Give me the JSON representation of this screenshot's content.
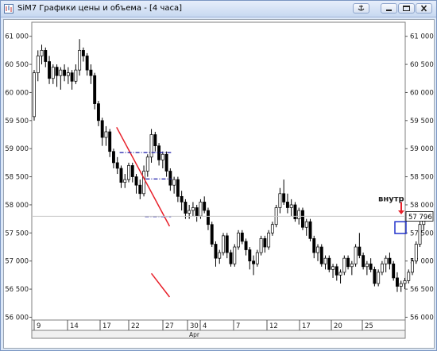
{
  "window": {
    "title": "SiM7 Графики цены и объема - [4 часа]",
    "icons": [
      "chart-app-icon",
      "anchor-icon",
      "minimize-icon",
      "restore-icon",
      "close-icon"
    ]
  },
  "chart_data": {
    "type": "candlestick",
    "y_ticks": [
      "61 000",
      "60 500",
      "60 000",
      "59 500",
      "59 000",
      "58 500",
      "58 000",
      "57 500",
      "57 000",
      "56 500",
      "56 000"
    ],
    "y_tick_values": [
      61000,
      60500,
      60000,
      59500,
      59000,
      58500,
      58000,
      57500,
      57000,
      56500,
      56000
    ],
    "ylim": [
      55950,
      61250
    ],
    "x_ticks": [
      "9",
      "14",
      "17",
      "22",
      "27",
      "30",
      "4",
      "7",
      "12",
      "17",
      "20",
      "25"
    ],
    "month_label": "Apr",
    "last_price": "57 796",
    "annotation": "внутр",
    "grid": "off",
    "colors": {
      "bull": "#ffffff",
      "bear": "#000000",
      "wick": "#000000",
      "trendline": "#e8202a",
      "level": "#1a1aa8",
      "marker": "#2233cc",
      "arrow": "#e8202a"
    },
    "candles": [
      [
        59570,
        60400,
        59500,
        60350
      ],
      [
        60350,
        60750,
        60200,
        60650
      ],
      [
        60650,
        60850,
        60500,
        60750
      ],
      [
        60750,
        60800,
        60450,
        60550
      ],
      [
        60550,
        60650,
        60150,
        60250
      ],
      [
        60250,
        60500,
        60150,
        60450
      ],
      [
        60450,
        60500,
        60100,
        60300
      ],
      [
        60300,
        60450,
        60050,
        60400
      ],
      [
        60400,
        60500,
        60200,
        60300
      ],
      [
        60300,
        60450,
        60150,
        60350
      ],
      [
        60350,
        60400,
        60050,
        60200
      ],
      [
        60200,
        60500,
        60150,
        60400
      ],
      [
        60400,
        60950,
        60300,
        60750
      ],
      [
        60750,
        60800,
        60550,
        60650
      ],
      [
        60650,
        60700,
        60300,
        60400
      ],
      [
        60400,
        60500,
        60150,
        60300
      ],
      [
        60300,
        60350,
        59700,
        59800
      ],
      [
        59800,
        59850,
        59400,
        59500
      ],
      [
        59500,
        59550,
        59050,
        59200
      ],
      [
        59200,
        59400,
        59050,
        59300
      ],
      [
        59300,
        59350,
        58850,
        58950
      ],
      [
        58950,
        59000,
        58650,
        58750
      ],
      [
        58750,
        58850,
        58550,
        58650
      ],
      [
        58650,
        58700,
        58300,
        58400
      ],
      [
        58400,
        58550,
        58300,
        58450
      ],
      [
        58450,
        58750,
        58400,
        58700
      ],
      [
        58700,
        58750,
        58400,
        58500
      ],
      [
        58500,
        58550,
        58200,
        58350
      ],
      [
        58350,
        58450,
        58100,
        58200
      ],
      [
        58200,
        58700,
        58150,
        58600
      ],
      [
        58600,
        58900,
        58500,
        58850
      ],
      [
        58850,
        59350,
        58750,
        59250
      ],
      [
        59250,
        59300,
        58950,
        59050
      ],
      [
        59050,
        59100,
        58700,
        58800
      ],
      [
        58800,
        58950,
        58650,
        58900
      ],
      [
        58900,
        58950,
        58500,
        58600
      ],
      [
        58600,
        58650,
        58250,
        58350
      ],
      [
        58350,
        58500,
        58200,
        58450
      ],
      [
        58450,
        58500,
        58050,
        58150
      ],
      [
        58150,
        58250,
        57900,
        58050
      ],
      [
        58050,
        58100,
        57750,
        57850
      ],
      [
        57850,
        58000,
        57750,
        57900
      ],
      [
        57900,
        58050,
        57800,
        57950
      ],
      [
        57950,
        58000,
        57700,
        57800
      ],
      [
        57800,
        58100,
        57750,
        58050
      ],
      [
        58050,
        58150,
        57850,
        57900
      ],
      [
        57900,
        57950,
        57550,
        57650
      ],
      [
        57650,
        57700,
        57250,
        57300
      ],
      [
        57300,
        57350,
        56900,
        57050
      ],
      [
        57050,
        57200,
        56950,
        57150
      ],
      [
        57150,
        57500,
        57100,
        57450
      ],
      [
        57450,
        57500,
        57050,
        57150
      ],
      [
        57150,
        57200,
        56900,
        56950
      ],
      [
        56950,
        57300,
        56900,
        57250
      ],
      [
        57250,
        57550,
        57200,
        57500
      ],
      [
        57500,
        57550,
        57300,
        57350
      ],
      [
        57350,
        57400,
        57100,
        57200
      ],
      [
        57200,
        57250,
        56850,
        57000
      ],
      [
        57000,
        57100,
        56750,
        56950
      ],
      [
        56950,
        57200,
        56900,
        57150
      ],
      [
        57150,
        57450,
        57100,
        57400
      ],
      [
        57400,
        57450,
        57150,
        57250
      ],
      [
        57250,
        57550,
        57200,
        57500
      ],
      [
        57500,
        57700,
        57450,
        57650
      ],
      [
        57650,
        58000,
        57600,
        57950
      ],
      [
        57950,
        58300,
        57850,
        58200
      ],
      [
        58200,
        58450,
        58000,
        58050
      ],
      [
        58050,
        58200,
        57850,
        57950
      ],
      [
        57950,
        58100,
        57800,
        58000
      ],
      [
        58000,
        58050,
        57700,
        57750
      ],
      [
        57750,
        57950,
        57650,
        57900
      ],
      [
        57900,
        57950,
        57550,
        57600
      ],
      [
        57600,
        57750,
        57450,
        57700
      ],
      [
        57700,
        57750,
        57350,
        57400
      ],
      [
        57400,
        57450,
        57050,
        57150
      ],
      [
        57150,
        57300,
        57000,
        57250
      ],
      [
        57250,
        57300,
        56900,
        56950
      ],
      [
        56950,
        57100,
        56850,
        57050
      ],
      [
        57050,
        57100,
        56800,
        56850
      ],
      [
        56850,
        56950,
        56700,
        56900
      ],
      [
        56900,
        56950,
        56650,
        56750
      ],
      [
        56750,
        56850,
        56600,
        56800
      ],
      [
        56800,
        57100,
        56750,
        57050
      ],
      [
        57050,
        57100,
        56850,
        56900
      ],
      [
        56900,
        57000,
        56750,
        56950
      ],
      [
        56950,
        57300,
        56900,
        57250
      ],
      [
        57250,
        57500,
        57050,
        57100
      ],
      [
        57100,
        57150,
        56850,
        56900
      ],
      [
        56900,
        57000,
        56750,
        56950
      ],
      [
        56950,
        57050,
        56800,
        56850
      ],
      [
        56850,
        56900,
        56550,
        56600
      ],
      [
        56600,
        56850,
        56550,
        56800
      ],
      [
        56800,
        57000,
        56750,
        56950
      ],
      [
        56950,
        57100,
        56800,
        57050
      ],
      [
        57050,
        57150,
        56850,
        56950
      ],
      [
        56950,
        57000,
        56650,
        56700
      ],
      [
        56700,
        56800,
        56450,
        56550
      ],
      [
        56550,
        56650,
        56450,
        56600
      ],
      [
        56600,
        56700,
        56500,
        56650
      ],
      [
        56650,
        56850,
        56600,
        56800
      ],
      [
        56800,
        57050,
        56750,
        57000
      ],
      [
        57000,
        57350,
        56950,
        57300
      ],
      [
        57300,
        57700,
        57250,
        57650
      ],
      [
        57650,
        57850,
        57550,
        57800
      ]
    ],
    "lines": [
      {
        "kind": "trendline",
        "from": [
          21.8,
          59380
        ],
        "to": [
          35.8,
          57620
        ]
      },
      {
        "kind": "trendline",
        "from": [
          31.0,
          56780
        ],
        "to": [
          35.8,
          56360
        ]
      },
      {
        "kind": "level",
        "from": [
          22.6,
          58930
        ],
        "to": [
          36.2,
          58930
        ]
      },
      {
        "kind": "level",
        "from": [
          29.5,
          58460
        ],
        "to": [
          36.2,
          58460
        ]
      },
      {
        "kind": "level",
        "from": [
          29.3,
          57790
        ],
        "to": [
          36.2,
          57790
        ]
      }
    ]
  }
}
